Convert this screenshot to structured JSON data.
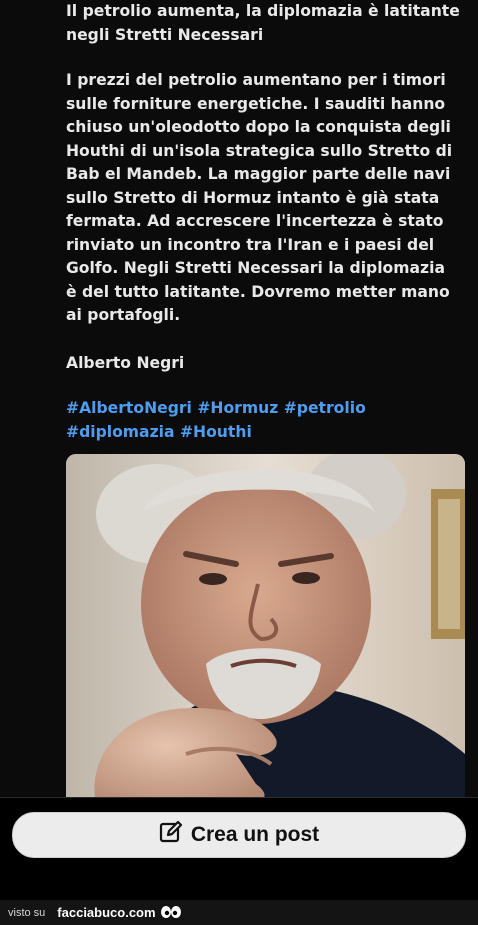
{
  "post": {
    "title_lines": [
      "Il petrolio aumenta, la diplomazia è latitante",
      "negli Stretti Necessari"
    ],
    "body_lines": [
      "I prezzi del petrolio aumentano per i timori",
      "sulle forniture energetiche. I sauditi hanno",
      "chiuso un'oleodotto dopo la conquista degli",
      "Houthi di un'isola strategica sullo Stretto di",
      "Bab el Mandeb. La maggior parte delle navi",
      "sullo Stretto di Hormuz intanto è già stata",
      "fermata. Ad accrescere l'incertezza è stato",
      "rinviato un incontro tra l'Iran e i paesi del",
      "Golfo. Negli Stretti Necessari la diplomazia",
      "è del tutto latitante. Dovremo metter mano",
      "ai portafogli."
    ],
    "author": "Alberto Negri",
    "hashtags_line1": [
      "#AlbertoNegri",
      "#Hormuz",
      "#petrolio"
    ],
    "hashtags_line2": [
      "#diplomazia",
      "#Houthi"
    ],
    "hashtag_color": "#4f9df0"
  },
  "actions": {
    "create_post_label": "Crea un post",
    "create_post_icon": "edit-icon"
  },
  "footer": {
    "visto_su": "visto su",
    "brand": "facciabuco.com",
    "brand_icon": "eyes-icon"
  }
}
